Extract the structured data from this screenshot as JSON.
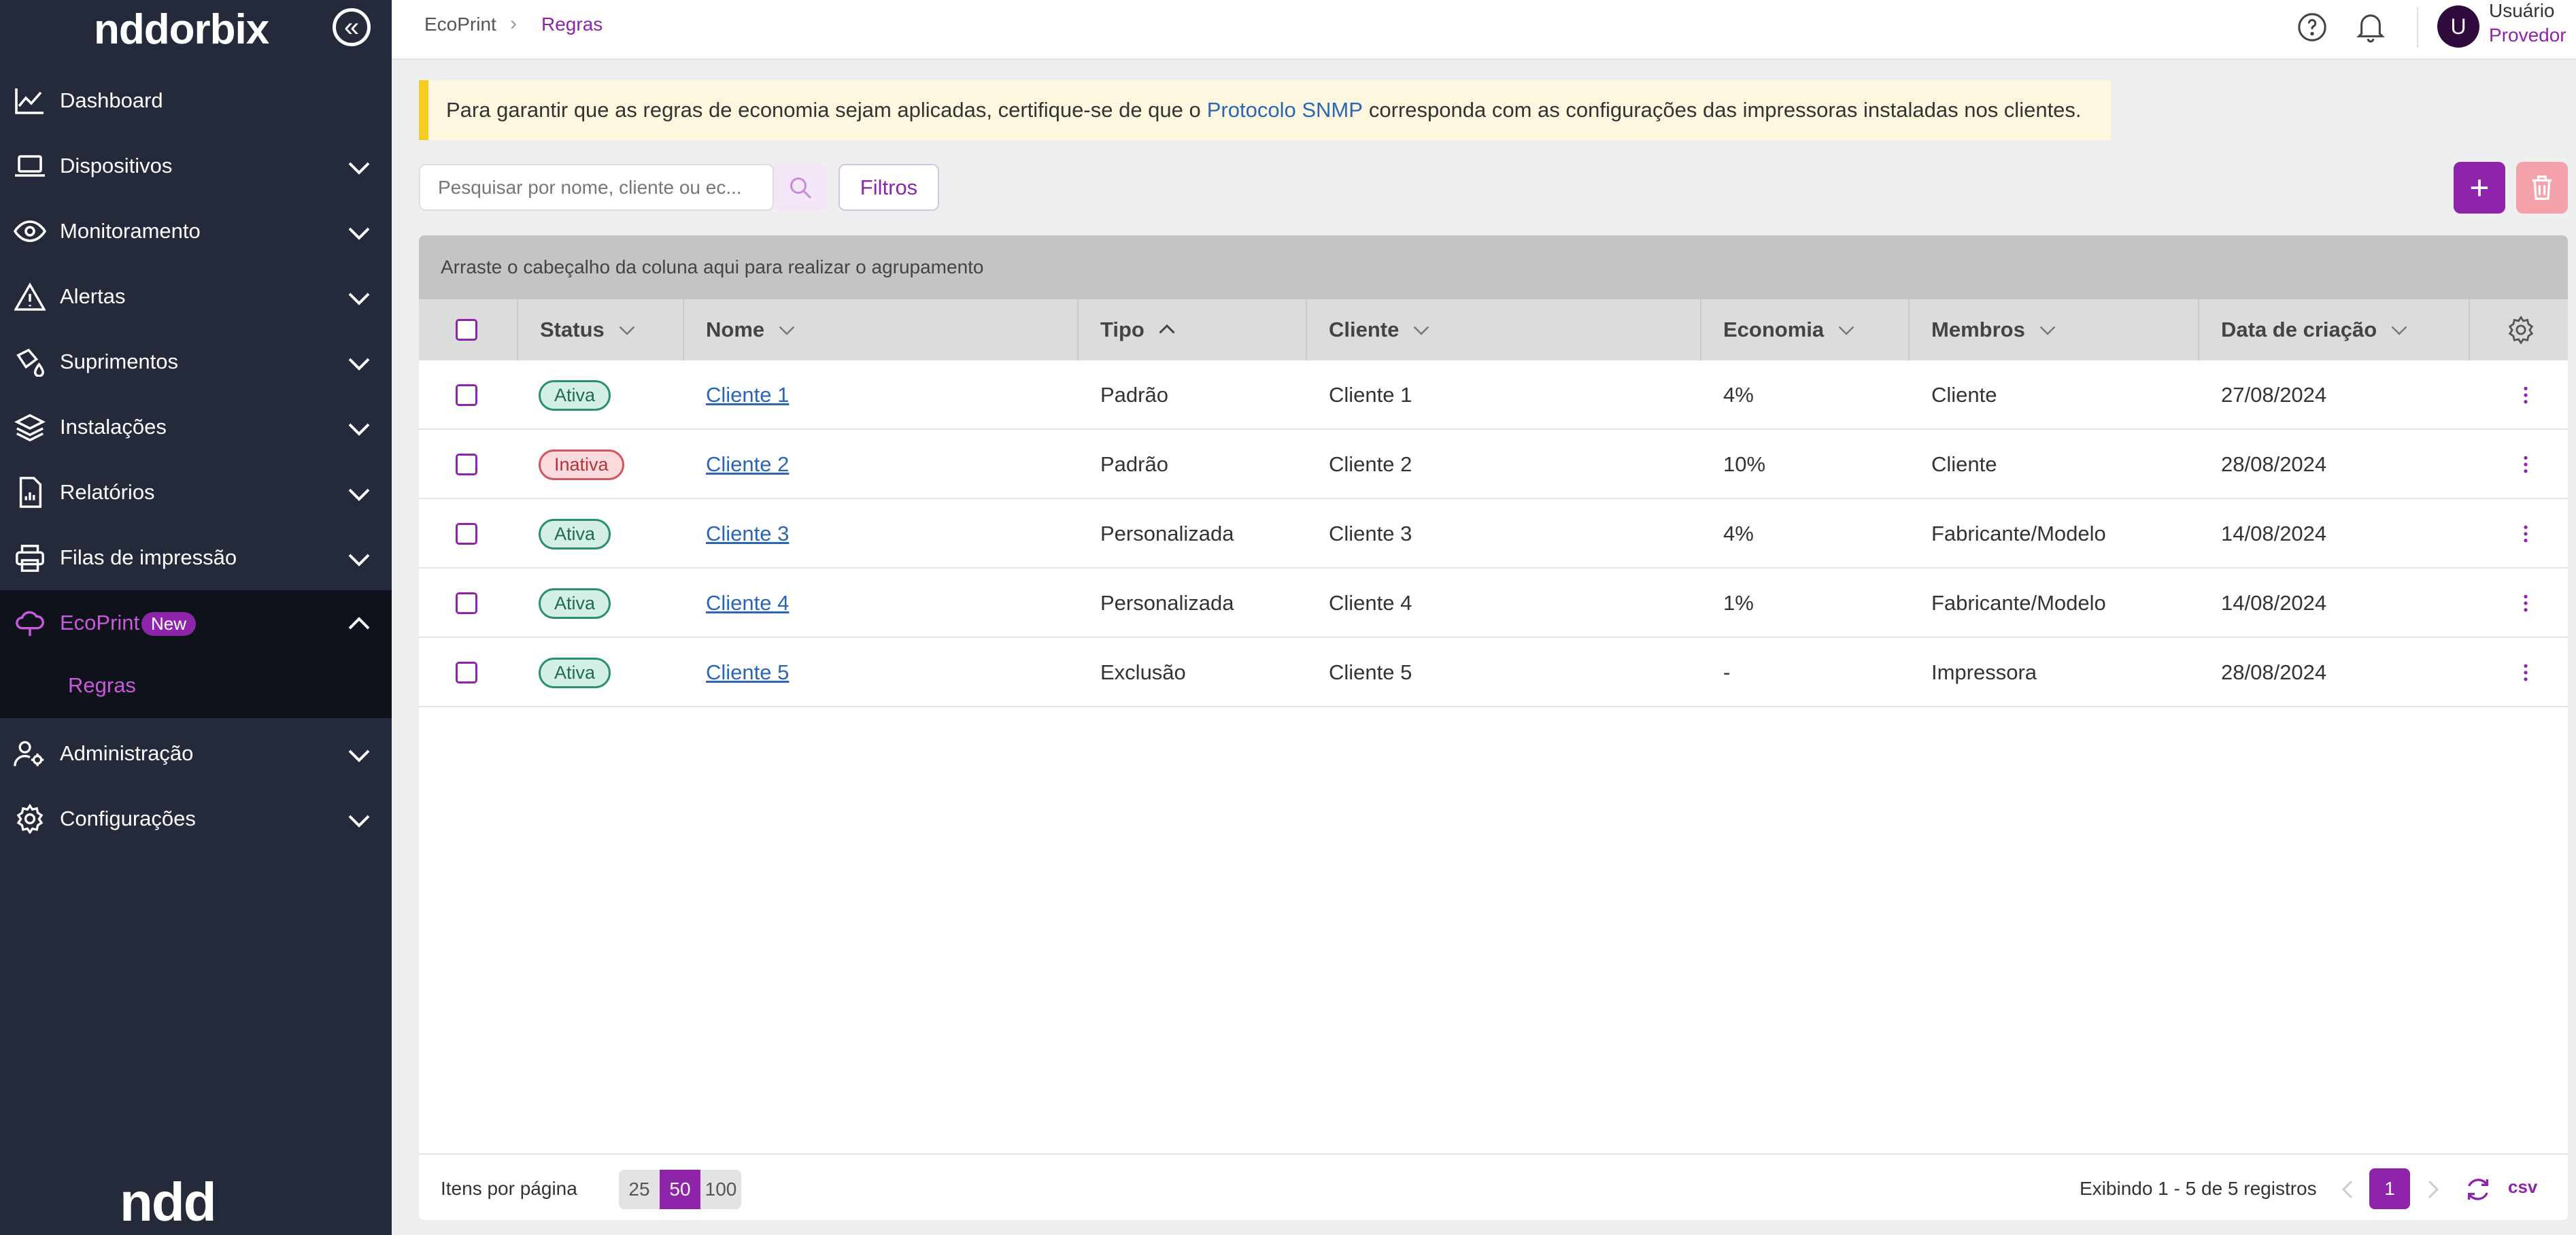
{
  "sidebar": {
    "logo": "nddorbix",
    "bottom_logo": "ndd",
    "items": [
      {
        "label": "Dashboard"
      },
      {
        "label": "Dispositivos"
      },
      {
        "label": "Monitoramento"
      },
      {
        "label": "Alertas"
      },
      {
        "label": "Suprimentos"
      },
      {
        "label": "Instalações"
      },
      {
        "label": "Relatórios"
      },
      {
        "label": "Filas de impressão"
      },
      {
        "label": "EcoPrint",
        "badge": "New"
      },
      {
        "label": "Administração"
      },
      {
        "label": "Configurações"
      }
    ],
    "sub_item": "Regras"
  },
  "header": {
    "breadcrumb": [
      "EcoPrint",
      "Regras"
    ],
    "user": {
      "initial": "U",
      "name": "Usuário",
      "role": "Provedor"
    }
  },
  "banner": {
    "text_before": "Para garantir que as regras de economia sejam aplicadas, certifique-se de que o",
    "link": "Protocolo SNMP",
    "text_after": "corresponda com as configurações das impressoras instaladas nos clientes."
  },
  "toolbar": {
    "search_placeholder": "Pesquisar por nome, cliente ou ec...",
    "filters_label": "Filtros",
    "add_label": "+"
  },
  "grid": {
    "group_hint": "Arraste o cabeçalho da coluna aqui para realizar o agrupamento",
    "columns": [
      "Status",
      "Nome",
      "Tipo",
      "Cliente",
      "Economia",
      "Membros",
      "Data de criação"
    ],
    "rows": [
      {
        "status": "Ativa",
        "nome": "Cliente 1",
        "tipo": "Padrão",
        "cliente": "Cliente 1",
        "economia": "4%",
        "membros": "Cliente",
        "data": "27/08/2024"
      },
      {
        "status": "Inativa",
        "nome": "Cliente 2",
        "tipo": "Padrão",
        "cliente": "Cliente 2",
        "economia": "10%",
        "membros": "Cliente",
        "data": "28/08/2024"
      },
      {
        "status": "Ativa",
        "nome": "Cliente 3",
        "tipo": "Personalizada",
        "cliente": "Cliente 3",
        "economia": "4%",
        "membros": "Fabricante/Modelo",
        "data": "14/08/2024"
      },
      {
        "status": "Ativa",
        "nome": "Cliente 4",
        "tipo": "Personalizada",
        "cliente": "Cliente 4",
        "economia": "1%",
        "membros": "Fabricante/Modelo",
        "data": "14/08/2024"
      },
      {
        "status": "Ativa",
        "nome": "Cliente 5",
        "tipo": "Exclusão",
        "cliente": "Cliente 5",
        "economia": "-",
        "membros": "Impressora",
        "data": "28/08/2024"
      }
    ]
  },
  "pager": {
    "label": "Itens por página",
    "sizes": [
      "25",
      "50",
      "100"
    ],
    "selected_size": "50",
    "info": "Exibindo  1 - 5 de 5 registros",
    "current_page": "1",
    "csv_label": "csv"
  },
  "colors": {
    "accent": "#8e24aa",
    "sidebar_bg": "#252a3b",
    "banner_border": "#f5cd1e",
    "link": "#2a66b8"
  }
}
